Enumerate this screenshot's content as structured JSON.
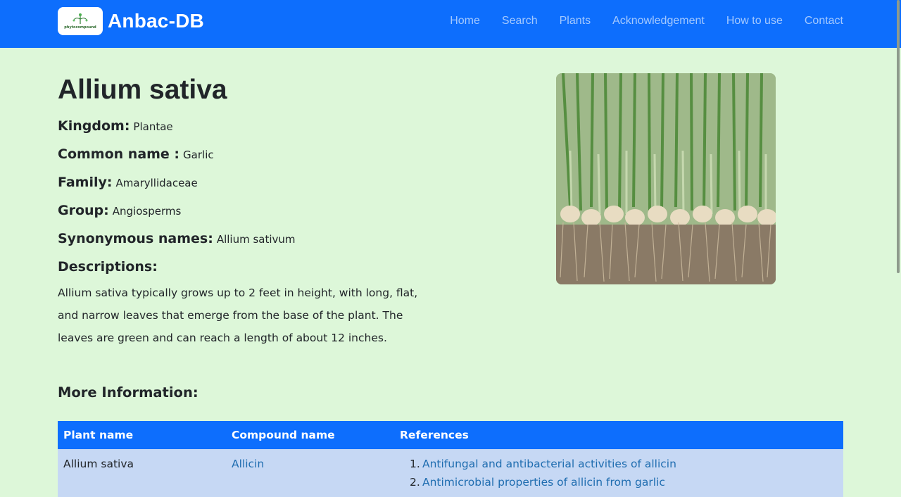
{
  "header": {
    "logo_text": "phytocompound",
    "brand": "Anbac-DB",
    "nav": [
      "Home",
      "Search",
      "Plants",
      "Acknowledgement",
      "How to use",
      "Contact"
    ]
  },
  "plant": {
    "name": "Allium sativa",
    "fields": [
      {
        "label": "Kingdom:",
        "value": "Plantae"
      },
      {
        "label": "Common name :",
        "value": "Garlic"
      },
      {
        "label": "Family:",
        "value": "Amaryllidaceae"
      },
      {
        "label": "Group:",
        "value": "Angiosperms"
      },
      {
        "label": "Synonymous names:",
        "value": "Allium sativum"
      }
    ],
    "descriptions_label": "Descriptions:",
    "description": "Allium sativa typically grows up to 2 feet in height, with long, flat, and narrow leaves that emerge from the base of the plant. The leaves are green and can reach a length of about 12 inches."
  },
  "more_info": {
    "title": "More Information:",
    "columns": [
      "Plant name",
      "Compound name",
      "References"
    ],
    "rows": [
      {
        "plant": "Allium sativa",
        "compound": "Allicin",
        "references": [
          {
            "num": "1.",
            "text": "Antifungal and antibacterial activities of allicin"
          },
          {
            "num": "2.",
            "text": "Antimicrobial properties of allicin from garlic"
          }
        ]
      }
    ]
  },
  "colors": {
    "navbar": "#0d6efd",
    "page_bg": "#ddf7d9",
    "table_row": "#c6d8f4",
    "link": "#1f6db0"
  }
}
